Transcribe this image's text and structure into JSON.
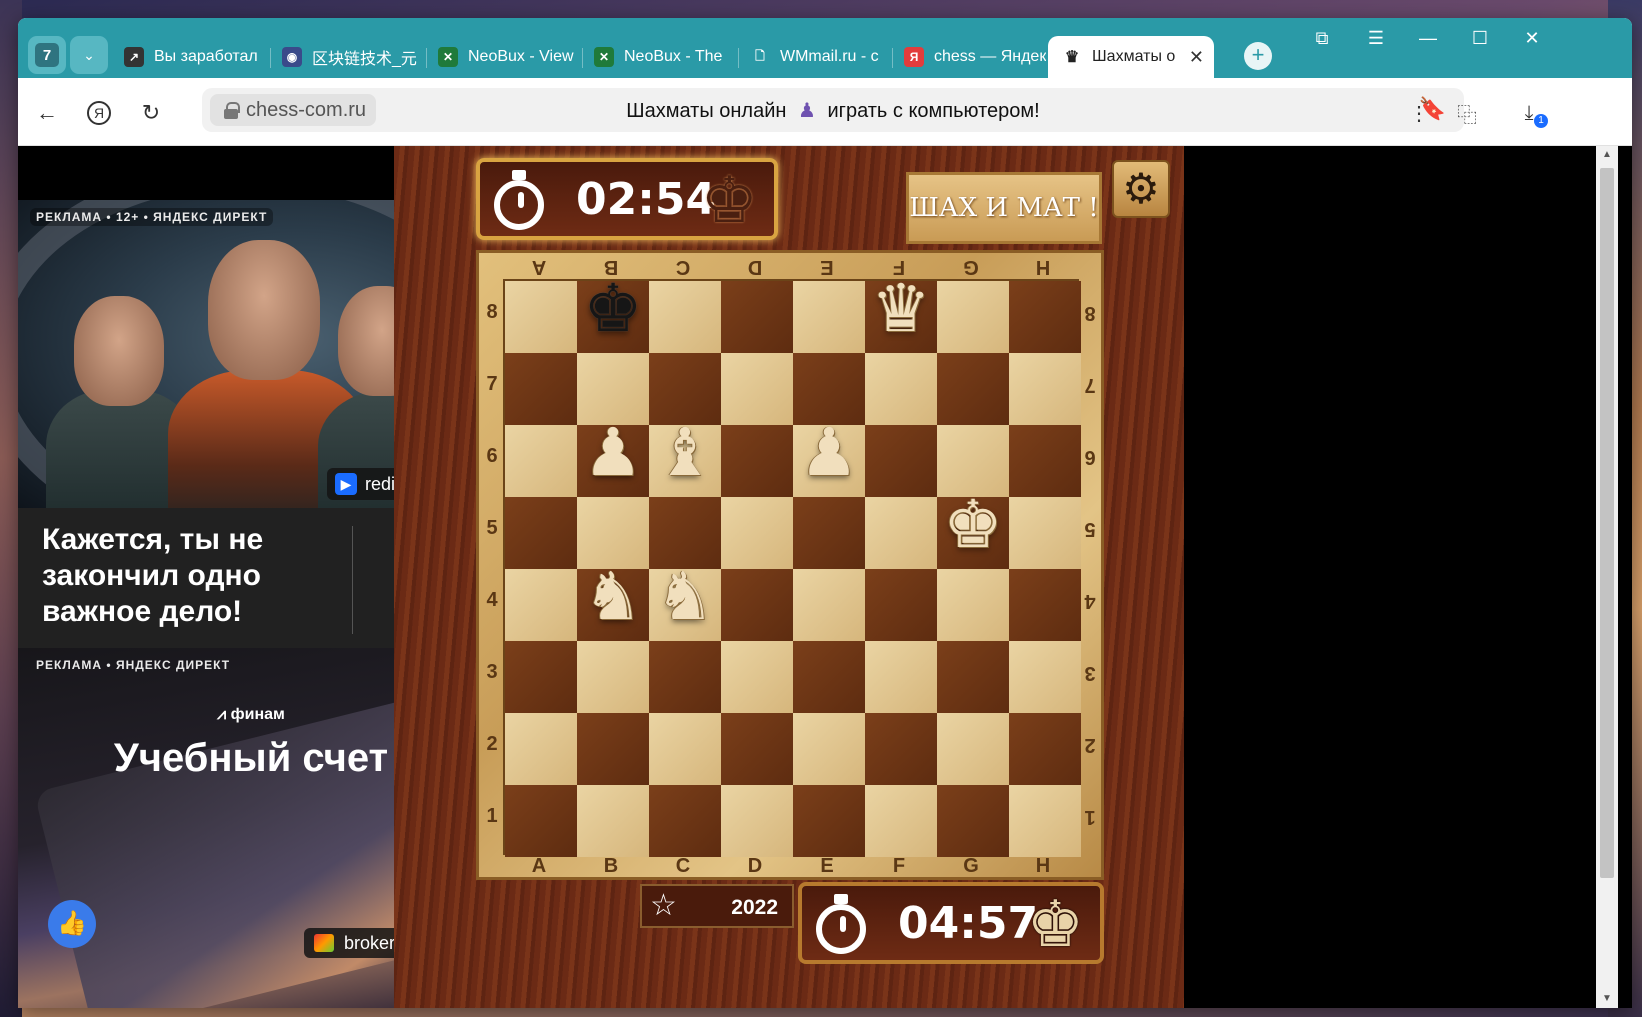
{
  "browser": {
    "tab_count": "7",
    "tabs": [
      {
        "title": "Вы заработал",
        "favicon_color": "#333333",
        "favicon_glyph": "↗"
      },
      {
        "title": "区块链技术_元",
        "favicon_color": "#3a4a8a",
        "favicon_glyph": "◉"
      },
      {
        "title": "NeoBux - View",
        "favicon_color": "#1f7a3a",
        "favicon_glyph": "✕"
      },
      {
        "title": "NeoBux - The",
        "favicon_color": "#1f7a3a",
        "favicon_glyph": "✕"
      },
      {
        "title": "WMmail.ru - c",
        "favicon_color": "#ffffff",
        "favicon_glyph": "🗋"
      },
      {
        "title": "chess — Яндек",
        "favicon_color": "#e23c3c",
        "favicon_glyph": "Я"
      }
    ],
    "active_tab": {
      "title": "Шахматы о",
      "favicon_glyph": "♛"
    },
    "window_controls": [
      "⧉",
      "☰",
      "—",
      "☐",
      "✕"
    ]
  },
  "address_bar": {
    "domain": "chess-com.ru",
    "title_before": "Шахматы онлайн",
    "title_icon": "♟",
    "title_after": "играть с компьютером!",
    "download_badge": "1"
  },
  "ads": {
    "ad1": {
      "label": "РЕКЛАМА • 12+ • ЯНДЕКС ДИРЕКТ",
      "source": "redir.lesta.ru",
      "headline": "Кажется, ты не закончил одно важное дело!",
      "arrow": "→"
    },
    "ad2": {
      "label": "РЕКЛАМА • ЯНДЕКС ДИРЕКТ",
      "brand": "финам",
      "headline": "Учебный счет",
      "source": "broker.finam.ru"
    }
  },
  "game": {
    "top_timer": "02:54",
    "bottom_timer": "04:57",
    "top_timer_piece": "♚",
    "bottom_timer_piece": "♚",
    "mate_button": "ШАХ И МАТ !",
    "settings_icon": "⚙",
    "year": "2022",
    "top_files": [
      "A",
      "B",
      "C",
      "D",
      "E",
      "F",
      "G",
      "H"
    ],
    "bottom_files": [
      "A",
      "B",
      "C",
      "D",
      "E",
      "F",
      "G",
      "H"
    ],
    "ranks": [
      "8",
      "7",
      "6",
      "5",
      "4",
      "3",
      "2",
      "1"
    ],
    "pieces": [
      {
        "square": "b8",
        "color": "black",
        "type": "king",
        "glyph": "♚"
      },
      {
        "square": "f8",
        "color": "white",
        "type": "queen",
        "glyph": "♛"
      },
      {
        "square": "b6",
        "color": "white",
        "type": "pawn",
        "glyph": "♟"
      },
      {
        "square": "c6",
        "color": "white",
        "type": "bishop",
        "glyph": "♝"
      },
      {
        "square": "e6",
        "color": "white",
        "type": "pawn",
        "glyph": "♟"
      },
      {
        "square": "g5",
        "color": "white",
        "type": "king",
        "glyph": "♚"
      },
      {
        "square": "b4",
        "color": "white",
        "type": "knight",
        "glyph": "♞"
      },
      {
        "square": "c4",
        "color": "white",
        "type": "knight",
        "glyph": "♞"
      }
    ]
  },
  "colors": {
    "tab_strip": "#2a9aa7",
    "accent_blue": "#3a7bea"
  }
}
